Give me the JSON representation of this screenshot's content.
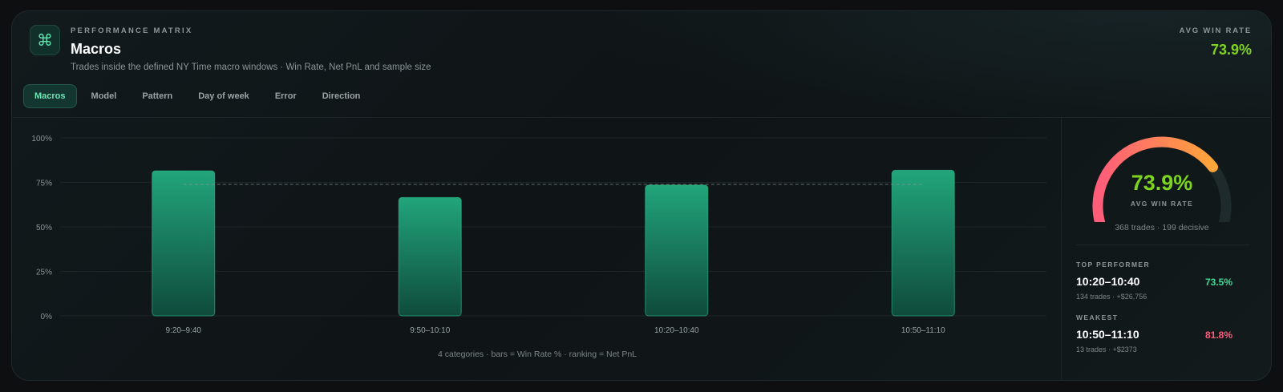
{
  "header": {
    "logo_glyph": "⌘",
    "eyebrow": "PERFORMANCE MATRIX",
    "title": "Macros",
    "subtitle": "Trades inside the defined NY Time macro windows · Win Rate, Net PnL and sample size",
    "avg_label": "AVG WIN RATE",
    "avg_value": "73.9%"
  },
  "tabs": [
    {
      "label": "Macros",
      "active": true
    },
    {
      "label": "Model",
      "active": false
    },
    {
      "label": "Pattern",
      "active": false
    },
    {
      "label": "Day of week",
      "active": false
    },
    {
      "label": "Error",
      "active": false
    },
    {
      "label": "Direction",
      "active": false
    }
  ],
  "chart_data": {
    "type": "bar",
    "categories": [
      "9:20–9:40",
      "9:50–10:10",
      "10:20–10:40",
      "10:50–11:10"
    ],
    "values": [
      81.5,
      66.5,
      73.5,
      81.8
    ],
    "ylim": [
      0,
      100
    ],
    "yticks": [
      "100%",
      "75%",
      "50%",
      "25%",
      "0%"
    ],
    "reference_line": 73.9,
    "grid": true,
    "bar_color": "#22a57a"
  },
  "footnote": "4 categories · bars = Win Rate % · ranking = Net PnL",
  "gauge": {
    "value": 73.9,
    "value_label": "73.9%",
    "label": "AVG WIN RATE",
    "sub": "368 trades · 199 decisive"
  },
  "top_performer": {
    "label": "TOP PERFORMER",
    "name": "10:20–10:40",
    "meta": "134 trades · +$26,756",
    "pct": "73.5%",
    "color": "#3ddc97"
  },
  "weakest": {
    "label": "WEAKEST",
    "name": "10:50–11:10",
    "meta": "13 trades · +$2373",
    "pct": "81.8%",
    "color": "#ff5c7a"
  }
}
